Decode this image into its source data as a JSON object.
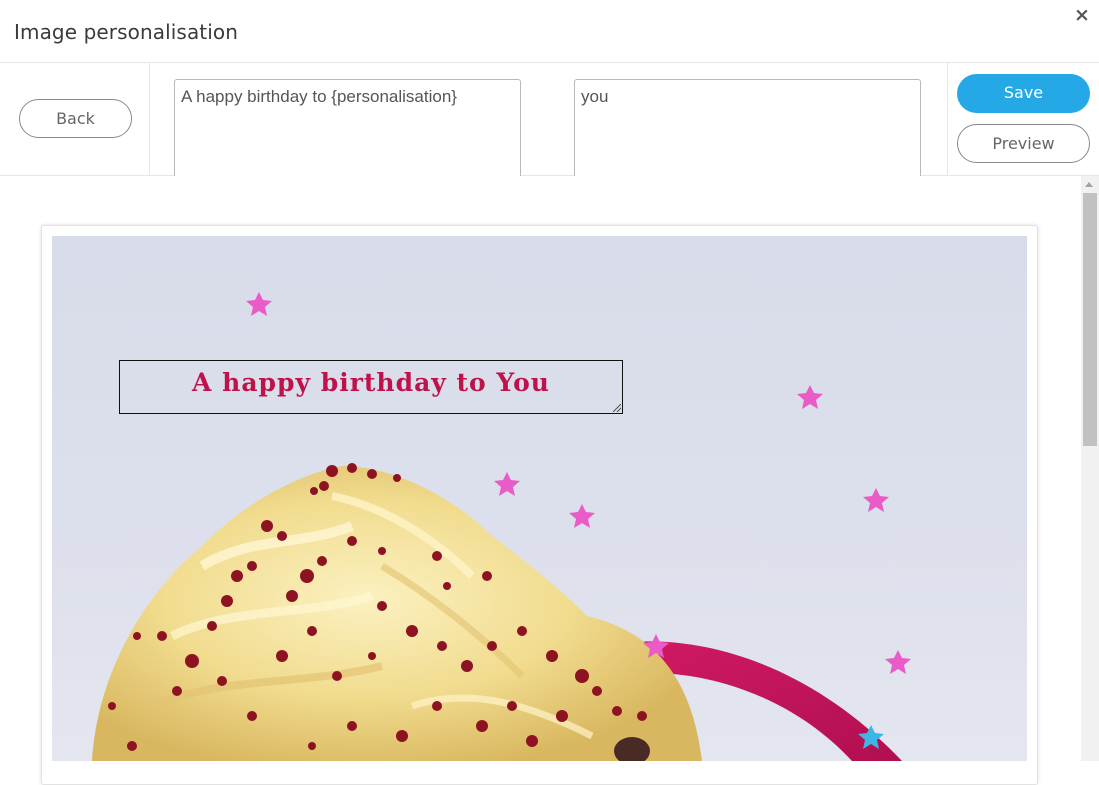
{
  "dialog": {
    "title": "Image personalisation",
    "close_symbol": "×"
  },
  "toolbar": {
    "back_label": "Back",
    "template_text": "A happy birthday to {personalisation}",
    "personalisation_value": "you",
    "save_label": "Save",
    "preview_label": "Preview"
  },
  "canvas": {
    "overlay_text": "A happy birthday to You",
    "image_subject": "cupcake with yellow frosting, red sprinkles and pink star confetti"
  },
  "colors": {
    "save_button": "#25a9e6",
    "overlay_text": "#c0124a"
  }
}
